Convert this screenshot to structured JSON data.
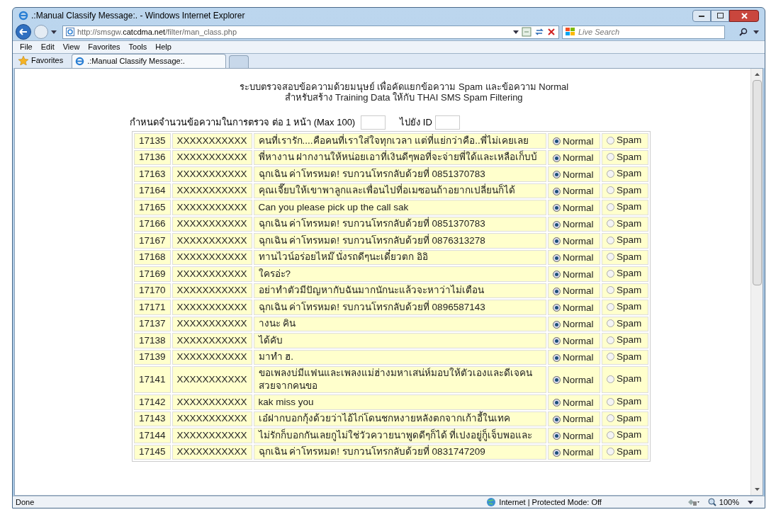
{
  "window": {
    "title": ".:Manual Classify Message:. - Windows Internet Explorer"
  },
  "address_bar": {
    "url_prefix": "http://smsgw.",
    "url_domain": "catcdma.net",
    "url_path": "/filter/man_class.php"
  },
  "search": {
    "placeholder": "Live Search"
  },
  "menu": [
    "File",
    "Edit",
    "View",
    "Favorites",
    "Tools",
    "Help"
  ],
  "favorites_button": "Favorites",
  "tabs": [
    {
      "label": ".:Manual Classify Message:.",
      "selected": true
    }
  ],
  "page": {
    "heading": [
      "ระบบตรวจสอบข้อความด้วยมนุษย์ เพื่อคัดแยกข้อความ Spam และข้อความ Normal",
      "สำหรับสร้าง Training Data ให้กับ THAI SMS Spam Filtering"
    ],
    "per_page_label": "กำหนดจำนวนข้อความในการตรวจ ต่อ 1 หน้า (Max 100)",
    "goto_label": "ไปยัง ID"
  },
  "table": {
    "rows": [
      {
        "id": "17135",
        "phone": "XXXXXXXXXXX",
        "message": "คนที่เรารัก....คือคนที่เราใส่ใจทุกเวลา แต่ที่แย่กว่าคือ..พี่ไม่เคยเลย",
        "options": [
          {
            "label": "Normal",
            "selected": true
          },
          {
            "label": "Spam",
            "selected": false
          }
        ]
      },
      {
        "id": "17136",
        "phone": "XXXXXXXXXXX",
        "message": "พี่หางาน ฝากงานให้หน่อยเอาที่เงินดีๆพอที่จะจ่ายพี่ใด้และเหลือเก็บบ้",
        "options": [
          {
            "label": "Normal",
            "selected": true
          },
          {
            "label": "Spam",
            "selected": false
          }
        ]
      },
      {
        "id": "17163",
        "phone": "XXXXXXXXXXX",
        "message": "ฉุกเฉิน ค่าโทรหมด! รบกวนโทรกลับด้วยที่ 0851370783",
        "options": [
          {
            "label": "Normal",
            "selected": true
          },
          {
            "label": "Spam",
            "selected": false
          }
        ]
      },
      {
        "id": "17164",
        "phone": "XXXXXXXXXXX",
        "message": "คุณเจี๊ยบให้เขาพาลูกและเพื่อนไปที่อเมซอนถ้าอยากเปลี่ยนก็ได้",
        "options": [
          {
            "label": "Normal",
            "selected": true
          },
          {
            "label": "Spam",
            "selected": false
          }
        ]
      },
      {
        "id": "17165",
        "phone": "XXXXXXXXXXX",
        "message": "Can you please pick up the call sak",
        "options": [
          {
            "label": "Normal",
            "selected": true
          },
          {
            "label": "Spam",
            "selected": false
          }
        ]
      },
      {
        "id": "17166",
        "phone": "XXXXXXXXXXX",
        "message": "ฉุกเฉิน ค่าโทรหมด! รบกวนโทรกลับด้วยที่ 0851370783",
        "options": [
          {
            "label": "Normal",
            "selected": true
          },
          {
            "label": "Spam",
            "selected": false
          }
        ]
      },
      {
        "id": "17167",
        "phone": "XXXXXXXXXXX",
        "message": "ฉุกเฉิน ค่าโทรหมด! รบกวนโทรกลับด้วยที่ 0876313278",
        "options": [
          {
            "label": "Normal",
            "selected": true
          },
          {
            "label": "Spam",
            "selected": false
          }
        ]
      },
      {
        "id": "17168",
        "phone": "XXXXXXXXXXX",
        "message": "ทานไวน์อร่อยไหม๊ นั่งรถดีๆนะเดี๋ยวตก อิอิ",
        "options": [
          {
            "label": "Normal",
            "selected": true
          },
          {
            "label": "Spam",
            "selected": false
          }
        ]
      },
      {
        "id": "17169",
        "phone": "XXXXXXXXXXX",
        "message": "ใครอ่ะ?",
        "options": [
          {
            "label": "Normal",
            "selected": true
          },
          {
            "label": "Spam",
            "selected": false
          }
        ]
      },
      {
        "id": "17170",
        "phone": "XXXXXXXXXXX",
        "message": "อย่าทำตัวมีปัญหากับฉันมากนักนะแล้วจะหาว่าไม่เตือน",
        "options": [
          {
            "label": "Normal",
            "selected": true
          },
          {
            "label": "Spam",
            "selected": false
          }
        ]
      },
      {
        "id": "17171",
        "phone": "XXXXXXXXXXX",
        "message": "ฉุกเฉิน ค่าโทรหมด! รบกวนโทรกลับด้วยที่ 0896587143",
        "options": [
          {
            "label": "Normal",
            "selected": true
          },
          {
            "label": "Spam",
            "selected": false
          }
        ]
      },
      {
        "id": "17137",
        "phone": "XXXXXXXXXXX",
        "message": "างนะ คิน",
        "options": [
          {
            "label": "Normal",
            "selected": true
          },
          {
            "label": "Spam",
            "selected": false
          }
        ]
      },
      {
        "id": "17138",
        "phone": "XXXXXXXXXXX",
        "message": "ได้คับ",
        "options": [
          {
            "label": "Normal",
            "selected": true
          },
          {
            "label": "Spam",
            "selected": false
          }
        ]
      },
      {
        "id": "17139",
        "phone": "XXXXXXXXXXX",
        "message": "มาทำ ฮ.",
        "options": [
          {
            "label": "Normal",
            "selected": true
          },
          {
            "label": "Spam",
            "selected": false
          }
        ]
      },
      {
        "id": "17141",
        "phone": "XXXXXXXXXXX",
        "message": "ขอเพลงบ่มีแฟนและเพลงแม่ฮ่างมหาเสน่ห์มอบให้ตัวเองและดีเจคนสวยจากคนขอ",
        "options": [
          {
            "label": "Normal",
            "selected": true
          },
          {
            "label": "Spam",
            "selected": false
          }
        ]
      },
      {
        "id": "17142",
        "phone": "XXXXXXXXXXX",
        "message": "kak miss you",
        "options": [
          {
            "label": "Normal",
            "selected": true
          },
          {
            "label": "Spam",
            "selected": false
          }
        ]
      },
      {
        "id": "17143",
        "phone": "XXXXXXXXXXX",
        "message": "เอ๋ฝากบอกกุ้งด้วยว่าไอ้ไก่โดนชกหงายหลังตกจากเก้าอี้ในเทค",
        "options": [
          {
            "label": "Normal",
            "selected": true
          },
          {
            "label": "Spam",
            "selected": false
          }
        ]
      },
      {
        "id": "17144",
        "phone": "XXXXXXXXXXX",
        "message": "ไม่รักก็บอกกันเลยกูไม่ใช่วัวควายนาพูดดีๆก็ได้ ที่เปงอยู่กู็เจ็บพอและ",
        "options": [
          {
            "label": "Normal",
            "selected": true
          },
          {
            "label": "Spam",
            "selected": false
          }
        ]
      },
      {
        "id": "17145",
        "phone": "XXXXXXXXXXX",
        "message": "ฉุกเฉิน ค่าโทรหมด! รบกวนโทรกลับด้วยที่ 0831747209",
        "options": [
          {
            "label": "Normal",
            "selected": true
          },
          {
            "label": "Spam",
            "selected": false
          }
        ]
      }
    ]
  },
  "status_bar": {
    "text": "Done",
    "zone": "Internet | Protected Mode: Off",
    "zoom": "100%"
  }
}
